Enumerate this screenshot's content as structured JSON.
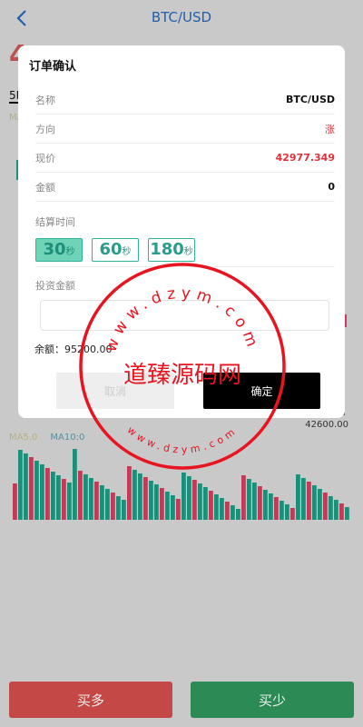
{
  "header": {
    "title": "BTC/USD"
  },
  "background": {
    "big_price": "4",
    "timeframe": "5M",
    "ma_top": "MA",
    "price_label": "42600.00",
    "ma5_label": "MA5.0",
    "ma10_label": "MA10:0"
  },
  "modal": {
    "title": "订单确认",
    "rows": [
      {
        "label": "名称",
        "value": "BTC/USD"
      },
      {
        "label": "方向",
        "value": "涨"
      },
      {
        "label": "现价",
        "value": "42977.349"
      },
      {
        "label": "金额",
        "value": "0"
      }
    ],
    "settle_label": "结算时间",
    "options": [
      {
        "num": "30",
        "unit": "秒",
        "selected": true
      },
      {
        "num": "60",
        "unit": "秒",
        "selected": false
      },
      {
        "num": "180",
        "unit": "秒",
        "selected": false
      }
    ],
    "invest_label": "投资金额",
    "amount_value": "",
    "amount_placeholder": "",
    "balance": "余额：95200.00",
    "cancel_label": "取消",
    "confirm_label": "确定"
  },
  "watermark": {
    "main": "道臻源码网",
    "url_top": "www.dzym.com",
    "url_bottom": "www.dzym.com"
  },
  "footer": {
    "buy_up": "买多",
    "buy_down": "买少"
  },
  "colors": {
    "up": "#c44845",
    "down": "#2c8a55",
    "accent": "#1f5fae",
    "stamp": "#e8141f"
  }
}
